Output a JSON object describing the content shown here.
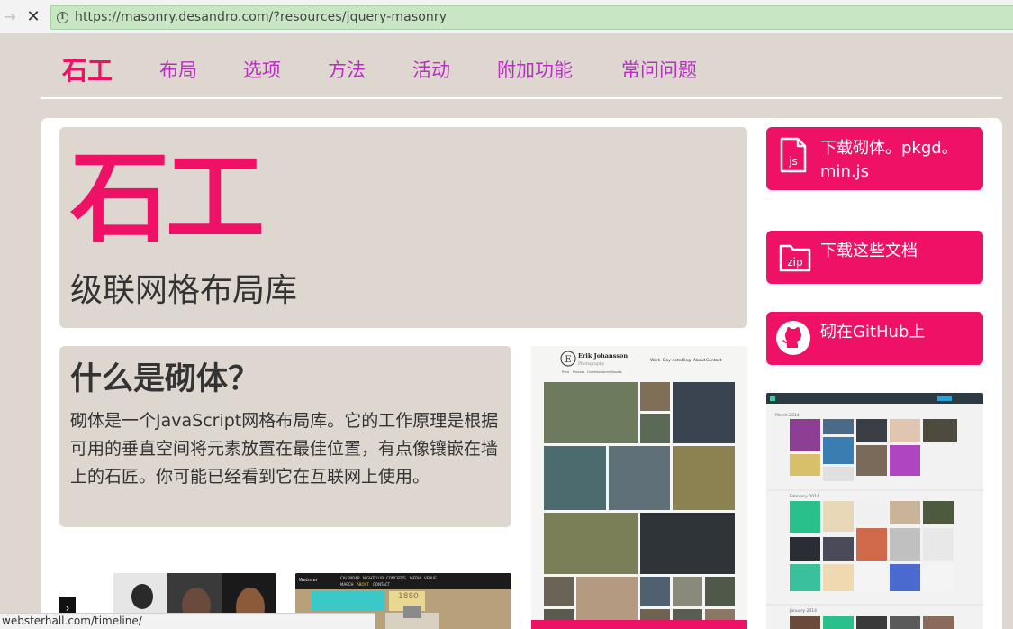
{
  "browser": {
    "url": "https://masonry.desandro.com/?resources/jquery-masonry",
    "status_url": "websterhall.com/timeline/"
  },
  "nav": {
    "logo": "石工",
    "items": [
      "布局",
      "选项",
      "方法",
      "活动",
      "附加功能",
      "常问问题"
    ]
  },
  "hero": {
    "title": "石工",
    "subtitle": "级联网格布局库"
  },
  "whatis": {
    "heading": "什么是砌体？",
    "body": "砌体是一个JavaScript网格布局库。它的工作原理是根据可用的垂直空间将元素放置在最佳位置，有点像镶嵌在墙上的石匠。你可能已经看到它在互联网上使用。"
  },
  "downloads": {
    "js_label": "下载砌体。pkgd。min.js",
    "js_icon_text": "js",
    "zip_label": "下载这些文档",
    "zip_icon_text": "zip",
    "github_label": "砌在GitHub上"
  },
  "thumbs": {
    "erik_name": "Erik Johansson",
    "erik_sub": "Photography",
    "erik_nav": [
      "Work",
      "Day notes",
      "Blog",
      "About",
      "Contact"
    ],
    "erik_nav2": [
      "Print",
      "Process",
      "Commissioned",
      "Ebooks"
    ],
    "timeline_month1": "March 2014",
    "timeline_month2": "February 2014",
    "timeline_month3": "January 2014",
    "webster_nav": [
      "CALENDAR",
      "NIGHTCLUB",
      "CONCERTS",
      "MEDIA",
      "VENUE"
    ],
    "webster_nav2": [
      "MARCH",
      "ABOUT",
      "CONTACT"
    ],
    "webster_year": "1880"
  },
  "colors": {
    "accent": "#ee1166",
    "nav_text": "#b82ec2",
    "page_bg": "#ddd7d0"
  }
}
